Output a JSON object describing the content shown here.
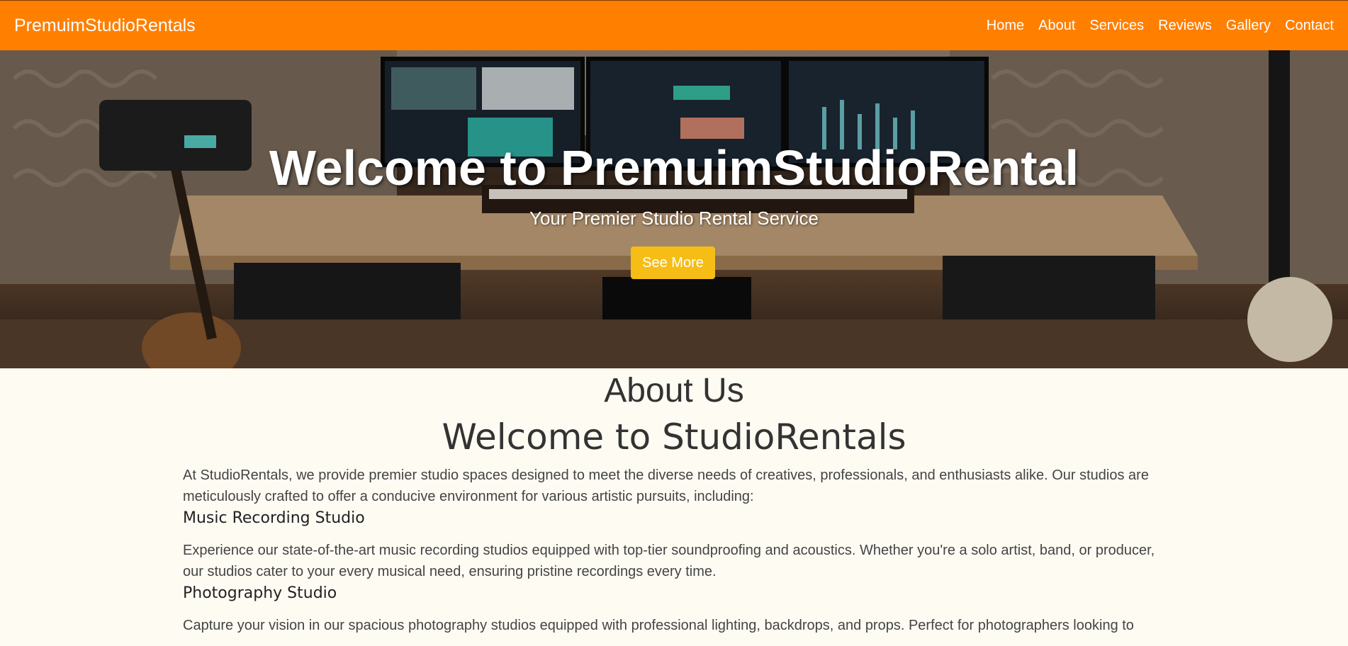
{
  "navbar": {
    "brand": "PremuimStudioRentals",
    "links": [
      "Home",
      "About",
      "Services",
      "Reviews",
      "Gallery",
      "Contact"
    ]
  },
  "hero": {
    "title": "Welcome to PremuimStudioRental",
    "subtitle": "Your Premier Studio Rental Service",
    "button_label": "See More"
  },
  "about": {
    "heading": "About Us",
    "subheading": "Welcome to StudioRentals",
    "intro": "At StudioRentals, we provide premier studio spaces designed to meet the diverse needs of creatives, professionals, and enthusiasts alike. Our studios are meticulously crafted to offer a conducive environment for various artistic pursuits, including:",
    "sections": [
      {
        "title": "Music Recording Studio",
        "text": "Experience our state-of-the-art music recording studios equipped with top-tier soundproofing and acoustics. Whether you're a solo artist, band, or producer, our studios cater to your every musical need, ensuring pristine recordings every time."
      },
      {
        "title": "Photography Studio",
        "text": "Capture your vision in our spacious photography studios equipped with professional lighting, backdrops, and props. Perfect for photographers looking to"
      }
    ]
  },
  "colors": {
    "navbar": "#ff7f00",
    "button": "#f6bd16",
    "background": "#fefbf3"
  }
}
